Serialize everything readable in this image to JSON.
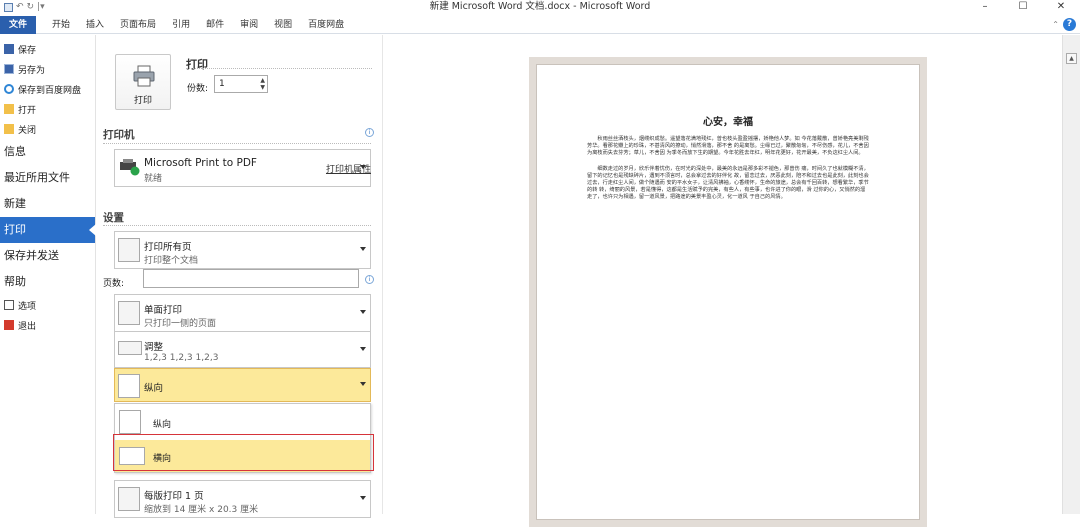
{
  "window": {
    "title": "新建 Microsoft Word 文档.docx - Microsoft Word",
    "controls": [
      "–",
      "☐",
      "✕"
    ]
  },
  "ribbon": {
    "tabs": [
      "文件",
      "开始",
      "插入",
      "页面布局",
      "引用",
      "邮件",
      "审阅",
      "视图",
      "百度网盘"
    ],
    "help": "?"
  },
  "nav": {
    "small_items_top": [
      "保存",
      "另存为",
      "保存到百度网盘",
      "打开",
      "关闭"
    ],
    "big_items": [
      "信息",
      "最近所用文件",
      "新建",
      "打印",
      "保存并发送",
      "帮助"
    ],
    "small_items_bottom": [
      "选项",
      "退出"
    ],
    "active": "打印"
  },
  "print": {
    "button_label": "打印",
    "title": "打印",
    "copies_label": "份数:",
    "copies_value": "1"
  },
  "printer": {
    "heading": "打印机",
    "name": "Microsoft Print to PDF",
    "status": "就绪",
    "properties_link": "打印机属性"
  },
  "settings": {
    "heading": "设置",
    "range_title": "打印所有页",
    "range_sub": "打印整个文档",
    "pages_label": "页数:",
    "sides_title": "单面打印",
    "sides_sub": "只打印一侧的页面",
    "collate_title": "调整",
    "collate_sub": "1,2,3   1,2,3   1,2,3",
    "orientation_value": "纵向",
    "orientation_options": [
      "纵向",
      "横向"
    ],
    "orientation_hover": "横向",
    "pages_per_sheet_title": "每版打印 1 页",
    "pages_per_sheet_sub": "缩放到 14 厘米 x 20.3 厘米"
  },
  "document": {
    "heading": "心安，幸福",
    "paragraphs": [
      "秋雨丝丝洒枝头，烟缕织成愁。遥望落花满地残红，曾也枝头盈盈摇摆，娇艳他人梦。如 今花落戴散，曾娇艳亮美剩残芳华。看那花瓣上的珍珠，不甚清风的撩动，悄然滑落，那不舍 的是离愁。尘缘已过，聚散匆匆，不尽伤感，花儿，不舍因为离枝而失去芬芳；草儿，不舍因 为季冬而放下生的期望。今年花胜去年红，明年花更好，花开最美，不负这红尘人间。",
      "细数走过的岁月，欣乐伴着忧伤，在时光的深处中，最美的永远是那多彩不褪色，那曾伤 痛，时间久了也就模糊不清，留下的记忆也是残缺碎片，遇到不须言时，总会拿过去的好伴化 故，留恋过去，厌恶此刻，陪不和过去也是此刻，此刻也会过去，行走红尘人间，做个随遇而 安的平水女子，让清风拂袖，心香缕怀，生命的旅途，总会有千回百转，想看繁华，季节的转 转，绮丽的风景，若是懂得，这都是生活赋予的完美，有些人，有些事，也许进了你的眼，滑 过你的心，又悄然的溜走了，也许只为相遇，留一道风景，把路途的美景丰盈心灵，化一道风 于自己的风情。"
    ]
  }
}
